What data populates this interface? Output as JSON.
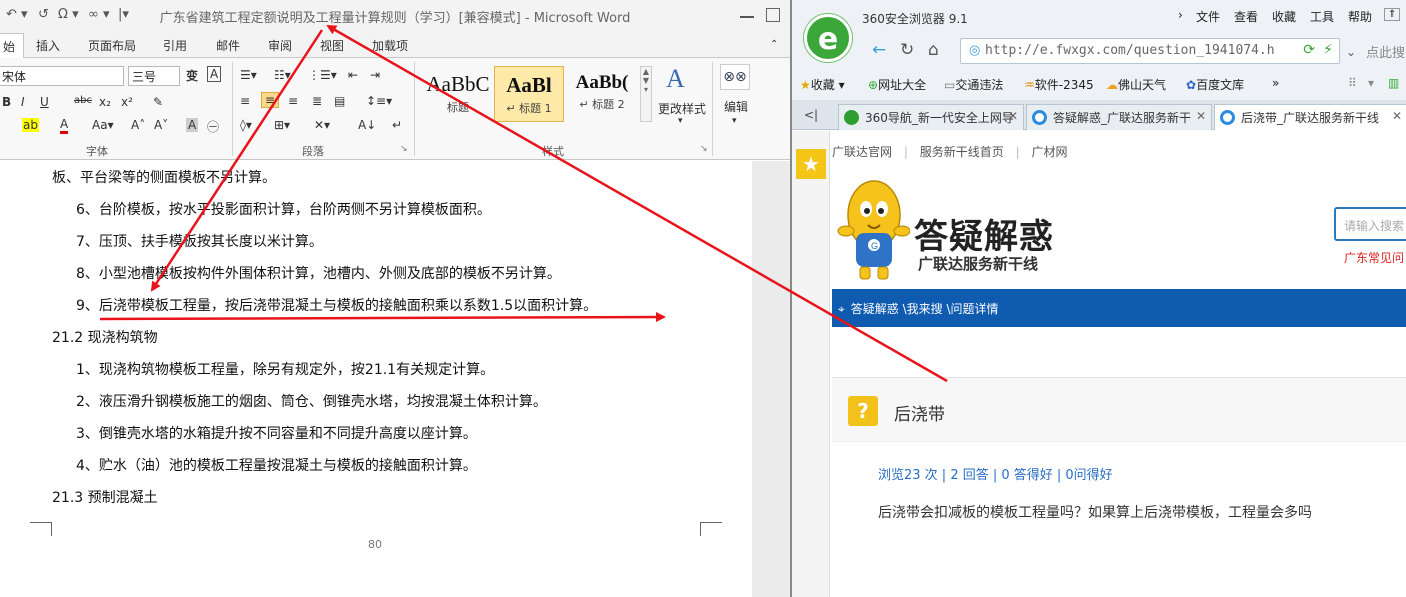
{
  "word": {
    "quick_access": [
      "↶ ▾",
      "↺",
      "Ω ▾",
      "∞ ▾",
      "|▾"
    ],
    "title": "广东省建筑工程定额说明及工程量计算规则（学习）[兼容模式] - Microsoft Word",
    "tabs": [
      "始",
      "插入",
      "页面布局",
      "引用",
      "邮件",
      "审阅",
      "视图",
      "加载项"
    ],
    "font": {
      "name": "宋体",
      "size": "三号"
    },
    "groups": {
      "font": "字体",
      "paragraph": "段落",
      "styles": "样式"
    },
    "styles": [
      {
        "preview": "AaBbC",
        "label": "标题"
      },
      {
        "preview": "AaBl",
        "label": "↵ 标题 1"
      },
      {
        "preview": "AaBb(",
        "label": "↵ 标题 2"
      }
    ],
    "change_styles": "更改样式",
    "edit": "编辑",
    "lines": [
      "板、平台梁等的侧面模板不另计算。",
      "6、台阶模板，按水平投影面积计算，台阶两侧不另计算模板面积。",
      "7、压顶、扶手模板按其长度以米计算。",
      "8、小型池槽模板按构件外围体积计算，池槽内、外侧及底部的模板不另计算。",
      "9、后浇带模板工程量，按后浇带混凝土与模板的接触面积乘以系数1.5以面积计算。",
      "21.2 现浇构筑物",
      "1、现浇构筑物模板工程量，除另有规定外，按21.1有关规定计算。",
      "2、液压滑升钢模板施工的烟囱、筒仓、倒锥壳水塔，均按混凝土体积计算。",
      "3、倒锥壳水塔的水箱提升按不同容量和不同提升高度以座计算。",
      "4、贮水（油）池的模板工程量按混凝土与模板的接触面积计算。",
      "21.3 预制混凝土"
    ],
    "page_number": "80"
  },
  "browser": {
    "title": "360安全浏览器 9.1",
    "menu": [
      "文件",
      "查看",
      "收藏",
      "工具",
      "帮助"
    ],
    "address": "http://e.fwxgx.com/question_1941074.h",
    "search_placeholder": "点此搜",
    "bookmarks": [
      "收藏 ▾",
      "网址大全",
      "交通违法",
      "软件-2345",
      "佛山天气",
      "百度文库",
      "»"
    ],
    "tabs": [
      {
        "label": "360导航_新一代安全上网导",
        "active": false
      },
      {
        "label": "答疑解惑_广联达服务新干",
        "active": false
      },
      {
        "label": "后浇带_广联达服务新干线",
        "active": true
      }
    ],
    "site": {
      "top_links": [
        "广联达官网",
        "|",
        "服务新干线首页",
        "|",
        "广材网"
      ],
      "slogan_big": "答疑解惑",
      "slogan_small": "广联达服务新干线",
      "search_placeholder": "请输入搜索",
      "hot": "广东常见问",
      "breadcrumb": "答疑解惑 \\我来搜 \\问题详情",
      "question_title": "后浇带",
      "stats": "浏览23 次 | 2 回答 | 0 答得好 | 0问得好",
      "question_text": "后浇带会扣减板的模板工程量吗？如果算上后浇带模板，工程量会多吗"
    }
  },
  "colors": {
    "arrow": "#e8141b",
    "site_blue": "#0f5bb0",
    "link": "#2a6cc4"
  }
}
